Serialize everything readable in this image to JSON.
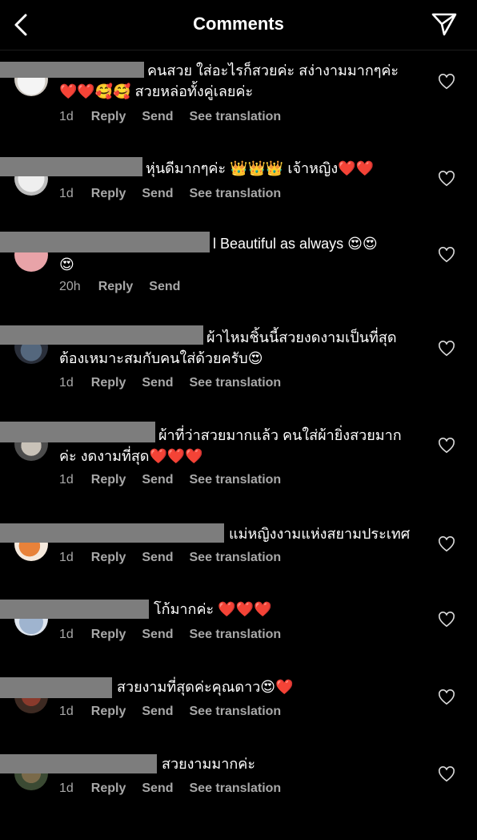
{
  "header": {
    "title": "Comments"
  },
  "comments": [
    {
      "line1": "คนสวย ใส่อะไรก็สวยค่ะ สง่างามมากๆค่ะ",
      "line2": "❤️❤️🥰🥰 สวยหล่อทั้งคู่เลยค่ะ",
      "time": "1d",
      "reply": "Reply",
      "send": "Send",
      "translate": "See translation"
    },
    {
      "line1": "หุ่นดีมากๆค่ะ 👑👑👑 เจ้าหญิง❤️❤️",
      "line2": "",
      "time": "1d",
      "reply": "Reply",
      "send": "Send",
      "translate": "See translation"
    },
    {
      "line1": "l Beautiful as always 😍😍",
      "line2": "😍",
      "time": "20h",
      "reply": "Reply",
      "send": "Send",
      "translate": ""
    },
    {
      "line1": "ผ้าไหมชิ้นนี้สวยงดงามเป็นที่สุด",
      "line2": "ต้องเหมาะสมกับคนใส่ด้วยครับ😍",
      "time": "1d",
      "reply": "Reply",
      "send": "Send",
      "translate": "See translation"
    },
    {
      "line1": "ผ้าที่ว่าสวยมากแล้ว คนใส่ผ้ายิ่งสวยมาก",
      "line2": "ค่ะ งดงามที่สุด❤️❤️❤️",
      "time": "1d",
      "reply": "Reply",
      "send": "Send",
      "translate": "See translation"
    },
    {
      "line1": "แม่หญิงงามแห่งสยามประเทศ",
      "line2": "",
      "time": "1d",
      "reply": "Reply",
      "send": "Send",
      "translate": "See translation"
    },
    {
      "line1": "โก้มากค่ะ ❤️❤️❤️",
      "line2": "",
      "time": "1d",
      "reply": "Reply",
      "send": "Send",
      "translate": "See translation"
    },
    {
      "line1": "สวยงามที่สุดค่ะคุณดาว😍❤️",
      "line2": "",
      "time": "1d",
      "reply": "Reply",
      "send": "Send",
      "translate": "See translation"
    },
    {
      "line1": "สวยงามมากค่ะ",
      "line2": "",
      "time": "1d",
      "reply": "Reply",
      "send": "Send",
      "translate": "See translation"
    }
  ],
  "colors": {
    "background": "#000000",
    "meta_text": "#a8a8a8",
    "redaction": "#7d7d7d"
  },
  "icons": {
    "back": "chevron-left-icon",
    "send": "paper-plane-icon",
    "like": "heart-outline-icon"
  }
}
